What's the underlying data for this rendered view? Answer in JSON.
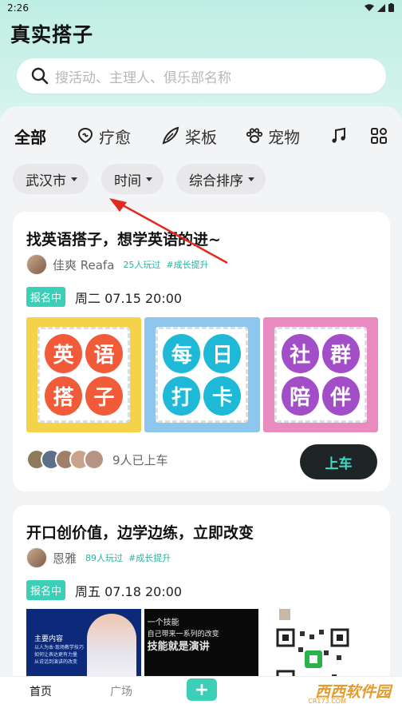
{
  "status_bar": {
    "time": "2:26"
  },
  "app": {
    "title": "真实搭子"
  },
  "search": {
    "placeholder": "搜活动、主理人、俱乐部名称"
  },
  "categories": [
    {
      "label": "全部",
      "active": true
    },
    {
      "label": "疗愈",
      "icon": "healing-icon"
    },
    {
      "label": "桨板",
      "icon": "paddleboard-icon"
    },
    {
      "label": "宠物",
      "icon": "paw-icon"
    }
  ],
  "filters": {
    "city": "武汉市",
    "time": "时间",
    "sort": "综合排序"
  },
  "cards": [
    {
      "title": "找英语搭子，想学英语的进~",
      "host_name": "佳爽 Reafa",
      "played": "25人玩过",
      "tag": "#成长提升",
      "status": "报名中",
      "datetime": "周二 07.15 20:00",
      "banner_tiles": [
        {
          "chars": [
            "英",
            "语",
            "搭",
            "子"
          ],
          "bg": "#f4d24a"
        },
        {
          "chars": [
            "每",
            "日",
            "打",
            "卡"
          ],
          "bg": "#8ec7ee"
        },
        {
          "chars": [
            "社",
            "群",
            "陪",
            "伴"
          ],
          "bg": "#e98bc0"
        }
      ],
      "joined": "9人已上车",
      "join_label": "上车"
    },
    {
      "title": "开口创价值，边学边练，立即改变",
      "host_name": "恩雅",
      "played": "89人玩过",
      "tag": "#成长提升",
      "status": "报名中",
      "datetime": "周五 07.18 20:00",
      "poster": {
        "heading": "主要内容",
        "lines": [
          "以人为本·现场教学技巧",
          "如何让表达更有力量",
          "从说话到演讲的改变"
        ]
      },
      "slide": {
        "lines": [
          "一个技能",
          "自己带来一系列的改变",
          "技能就是演讲"
        ]
      }
    }
  ],
  "tabbar": {
    "home": "首页",
    "plaza": "广场",
    "plus": "+"
  },
  "watermark": {
    "text": "西西软件园",
    "sub": "CR173.COM"
  },
  "colors": {
    "accent": "#3ccfb8",
    "dark_button": "#1f2427",
    "header_bg": "#c6efe6"
  }
}
